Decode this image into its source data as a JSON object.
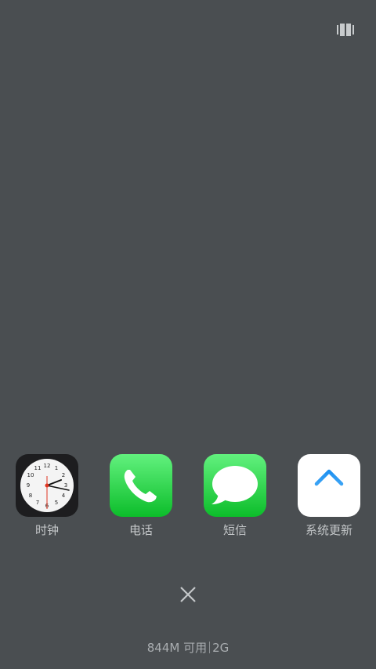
{
  "apps": [
    {
      "label": "时钟",
      "icon": "clock-icon"
    },
    {
      "label": "电话",
      "icon": "phone-icon"
    },
    {
      "label": "短信",
      "icon": "messages-icon"
    },
    {
      "label": "系统更新",
      "icon": "update-arrow-icon"
    }
  ],
  "memory": {
    "available": "844M 可用",
    "total": "2G"
  },
  "colors": {
    "background": "#4a4e51",
    "label_text": "#c3c6c8",
    "green_top": "#62f17e",
    "green_bottom": "#0cbd2a",
    "update_arrow": "#1e90f0"
  }
}
